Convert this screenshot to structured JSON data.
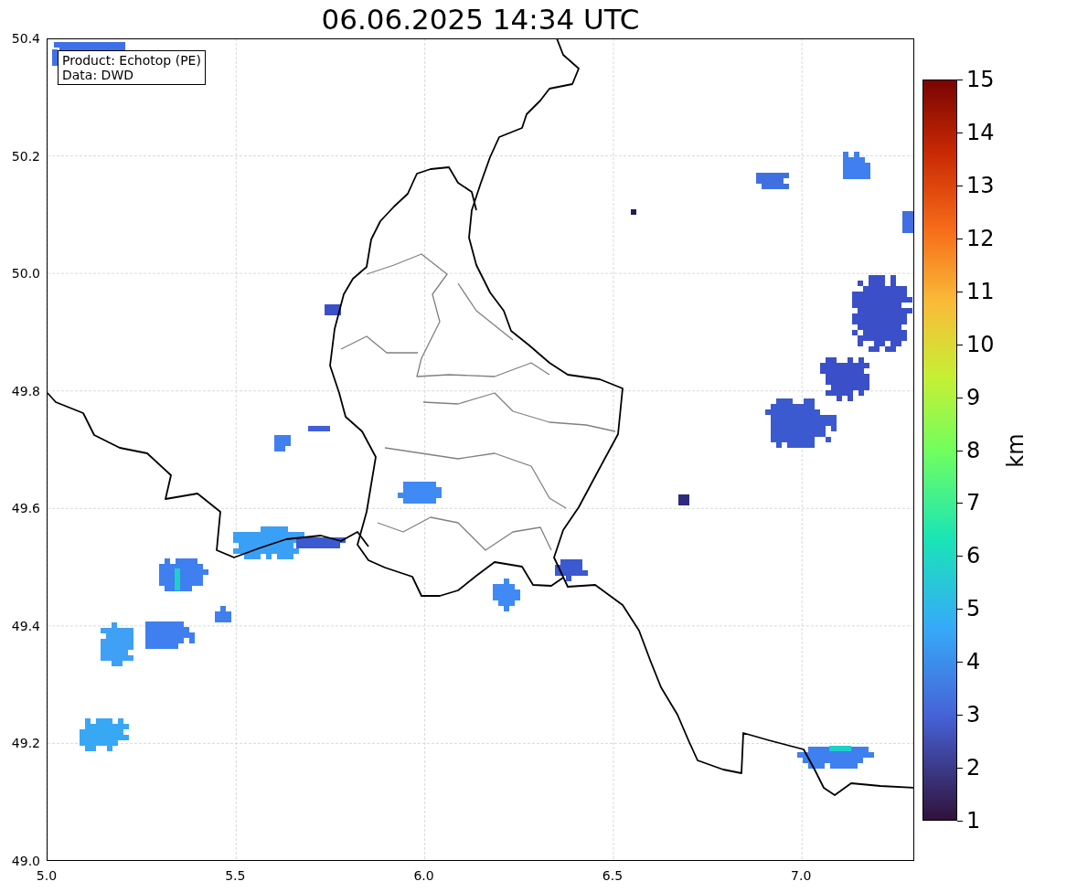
{
  "title": "06.06.2025 14:34 UTC",
  "info_box": [
    "Product: Echotop (PE)",
    "Data: DWD"
  ],
  "x_axis": {
    "ticks": [
      "5.0",
      "5.5",
      "6.0",
      "6.5",
      "7.0"
    ]
  },
  "y_axis": {
    "ticks": [
      "50.4",
      "50.2",
      "50.0",
      "49.8",
      "49.6",
      "49.4",
      "49.2",
      "49.0"
    ]
  },
  "colorbar": {
    "label": "km",
    "ticks": [
      "15",
      "14",
      "13",
      "12",
      "11",
      "10",
      "9",
      "8",
      "7",
      "6",
      "5",
      "4",
      "3",
      "2",
      "1"
    ]
  }
}
